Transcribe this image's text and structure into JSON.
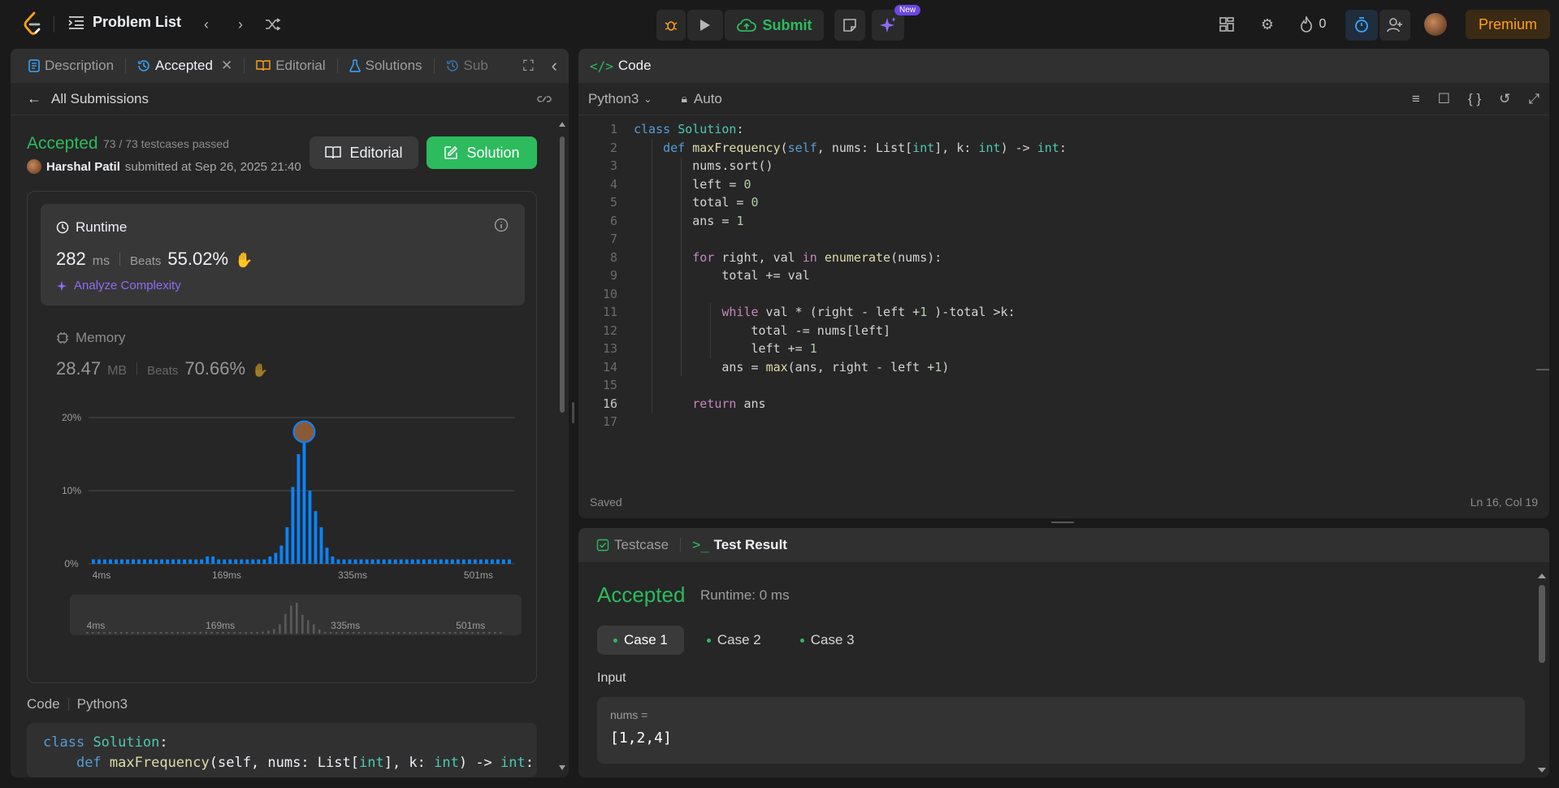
{
  "topbar": {
    "problem_list": "Problem List",
    "submit": "Submit",
    "new_badge": "New",
    "streak": "0",
    "premium": "Premium"
  },
  "left": {
    "tabs": [
      "Description",
      "Accepted",
      "Editorial",
      "Solutions",
      "Sub"
    ],
    "all_submissions": "All Submissions",
    "status": "Accepted",
    "testcases": "73 / 73 testcases passed",
    "user": "Harshal Patil",
    "submitted_at": "submitted at Sep 26, 2025 21:40",
    "editorial_btn": "Editorial",
    "solution_btn": "Solution",
    "runtime": {
      "label": "Runtime",
      "value": "282",
      "unit": "ms",
      "beats_label": "Beats",
      "beats": "55.02%",
      "analyze": "Analyze Complexity"
    },
    "memory": {
      "label": "Memory",
      "value": "28.47",
      "unit": "MB",
      "beats_label": "Beats",
      "beats": "70.66%"
    },
    "code_label": "Code",
    "code_lang": "Python3",
    "snippet": [
      "class Solution:",
      "    def maxFrequency(self, nums: List[int], k: int) -> int:"
    ]
  },
  "chart_data": {
    "type": "bar",
    "title": "",
    "xlabel": "",
    "ylabel": "",
    "ylim": [
      0,
      20
    ],
    "yticks": [
      "0%",
      "10%",
      "20%"
    ],
    "xticks": [
      "4ms",
      "169ms",
      "335ms",
      "501ms"
    ],
    "x_range_ms": [
      4,
      560
    ],
    "values": [
      0.6,
      0.6,
      0.6,
      0.6,
      0.6,
      0.6,
      0.6,
      0.6,
      0.6,
      0.6,
      0.6,
      0.6,
      0.6,
      0.6,
      0.6,
      0.6,
      0.6,
      0.6,
      0.6,
      0.6,
      1.0,
      1.0,
      0.6,
      0.6,
      0.6,
      0.6,
      0.6,
      0.6,
      0.6,
      0.6,
      0.6,
      1.0,
      1.5,
      2.5,
      5.0,
      10.5,
      15.0,
      16.5,
      10.0,
      7.2,
      5.0,
      2.2,
      1.0,
      0.6,
      0.6,
      0.6,
      0.6,
      0.6,
      0.6,
      0.6,
      0.6,
      0.6,
      0.6,
      0.6,
      0.6,
      0.6,
      0.6,
      0.6,
      0.6,
      0.6,
      0.6,
      0.6,
      0.6,
      0.6,
      0.6,
      0.6,
      0.6,
      0.6,
      0.6,
      0.6,
      0.6,
      0.6,
      0.6,
      0.6
    ],
    "highlight_index": 37,
    "grid": true,
    "bar_color": "#0a84ff"
  },
  "editor": {
    "title": "Code",
    "language": "Python3",
    "mode": "Auto",
    "saved": "Saved",
    "cursor": "Ln 16, Col 19",
    "current_line": 16
  },
  "result": {
    "tab_testcase": "Testcase",
    "tab_result": "Test Result",
    "status": "Accepted",
    "runtime": "Runtime: 0 ms",
    "cases": [
      "Case 1",
      "Case 2",
      "Case 3"
    ],
    "input_label": "Input",
    "input_name": "nums =",
    "input_value": "[1,2,4]"
  }
}
